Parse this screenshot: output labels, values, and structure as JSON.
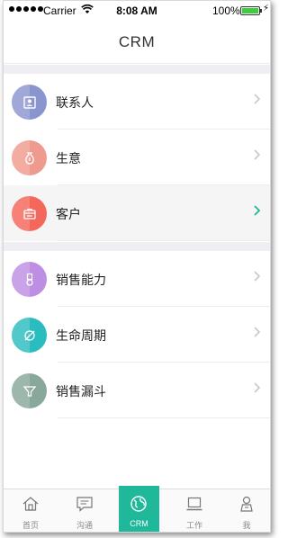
{
  "status_bar": {
    "carrier": "Carrier",
    "time": "8:08 AM",
    "battery": "100%"
  },
  "nav": {
    "title": "CRM"
  },
  "menu_groups": [
    {
      "items": [
        {
          "label": "联系人",
          "icon": "contacts-icon",
          "color": "#8a95cf",
          "active": false
        },
        {
          "label": "生意",
          "icon": "money-bag-icon",
          "color": "#ef9a8e",
          "active": false
        },
        {
          "label": "客户",
          "icon": "customer-icon",
          "color": "#f4675a",
          "active": true
        }
      ]
    },
    {
      "items": [
        {
          "label": "销售能力",
          "icon": "medal-icon",
          "color": "#bd8ee3",
          "active": false
        },
        {
          "label": "生命周期",
          "icon": "lifecycle-icon",
          "color": "#2bbcbf",
          "active": false
        },
        {
          "label": "销售漏斗",
          "icon": "funnel-icon",
          "color": "#88a89c",
          "active": false
        }
      ]
    }
  ],
  "colors": {
    "accent": "#1fb89a",
    "chevron": "#c8c8c8",
    "chevron_active": "#1fb89a"
  },
  "tabs": [
    {
      "label": "首页",
      "icon": "home-icon"
    },
    {
      "label": "沟通",
      "icon": "chat-icon"
    },
    {
      "label": "CRM",
      "icon": "globe-icon",
      "selected": true
    },
    {
      "label": "工作",
      "icon": "laptop-icon"
    },
    {
      "label": "我",
      "icon": "profile-icon"
    }
  ]
}
